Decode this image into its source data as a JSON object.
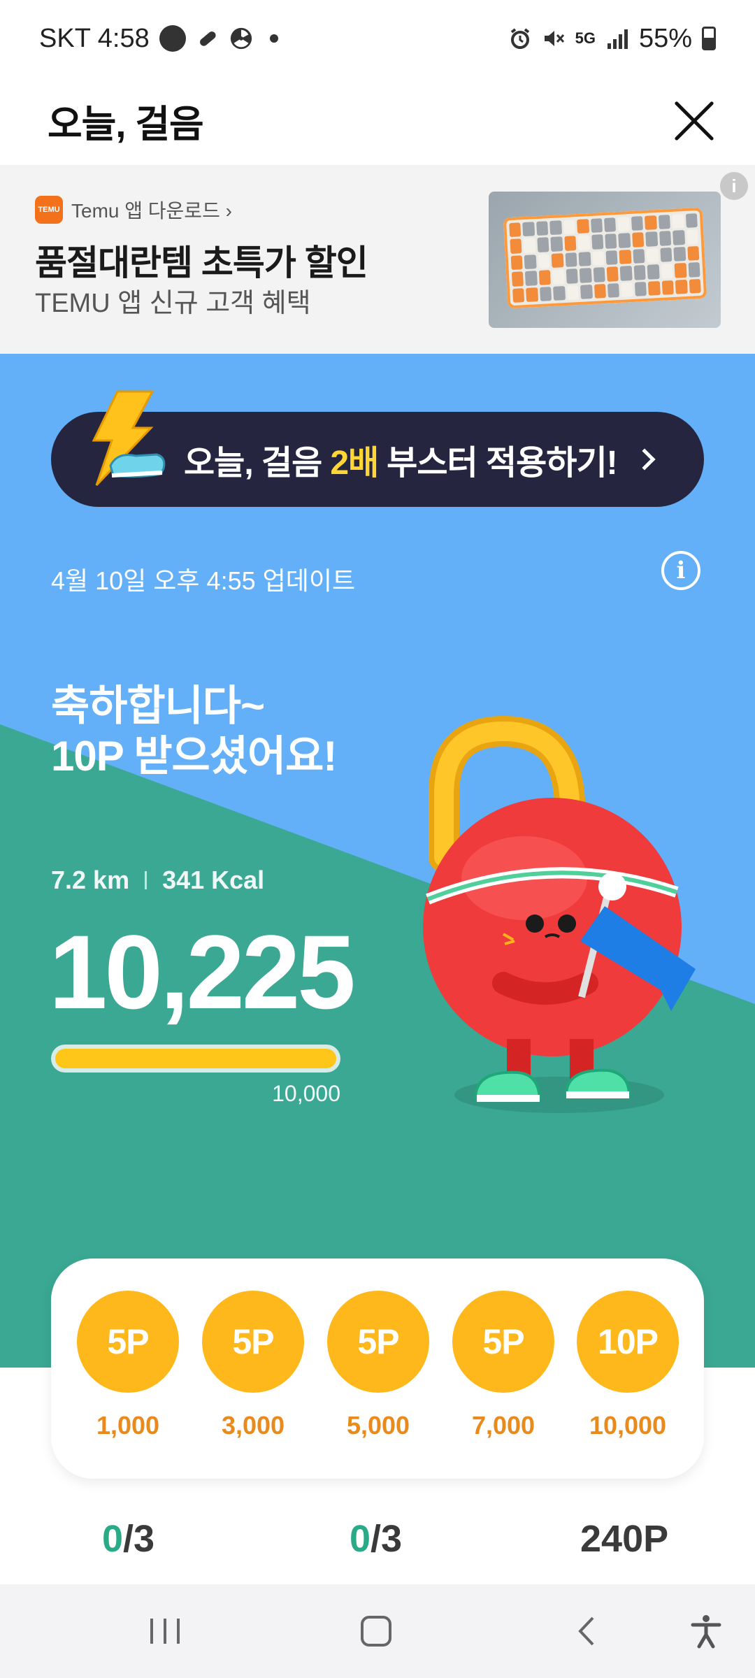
{
  "status_bar": {
    "carrier_time": "SKT 4:58",
    "network": "5G",
    "battery": "55%",
    "icons": [
      "lock-app-icon",
      "pill-icon",
      "fan-icon",
      "alarm-icon",
      "mute-icon",
      "signal-icon",
      "battery-icon"
    ]
  },
  "header": {
    "title": "오늘, 걸음"
  },
  "ad": {
    "source": "Temu 앱 다운로드 ›",
    "logo_text": "TEMU",
    "title": "품절대란템 초특가 할인",
    "subtitle": "TEMU 앱 신규 고객 혜택",
    "info": "i"
  },
  "booster": {
    "prefix": "오늘, 걸음",
    "highlight": "2배",
    "suffix": "부스터 적용하기!"
  },
  "update": {
    "text": "4월 10일 오후 4:55 업데이트"
  },
  "congrats": {
    "line1": "축하합니다~",
    "line2": "10P 받으셨어요!"
  },
  "stats": {
    "distance": "7.2 km",
    "calories": "341 Kcal",
    "steps": "10,225",
    "goal": "10,000",
    "progress": 1.0
  },
  "rewards": [
    {
      "points": "5P",
      "steps": "1,000"
    },
    {
      "points": "5P",
      "steps": "3,000"
    },
    {
      "points": "5P",
      "steps": "5,000"
    },
    {
      "points": "5P",
      "steps": "7,000"
    },
    {
      "points": "10P",
      "steps": "10,000"
    }
  ],
  "counters": {
    "first_value": "0",
    "first_total": "/3",
    "second_value": "0",
    "second_total": "/3",
    "points_total": "240P"
  },
  "colors": {
    "sky": "#63b0f8",
    "grass": "#3aa893",
    "coin": "#ffb81c",
    "booster_bg": "#25253f",
    "highlight": "#ffd633"
  }
}
